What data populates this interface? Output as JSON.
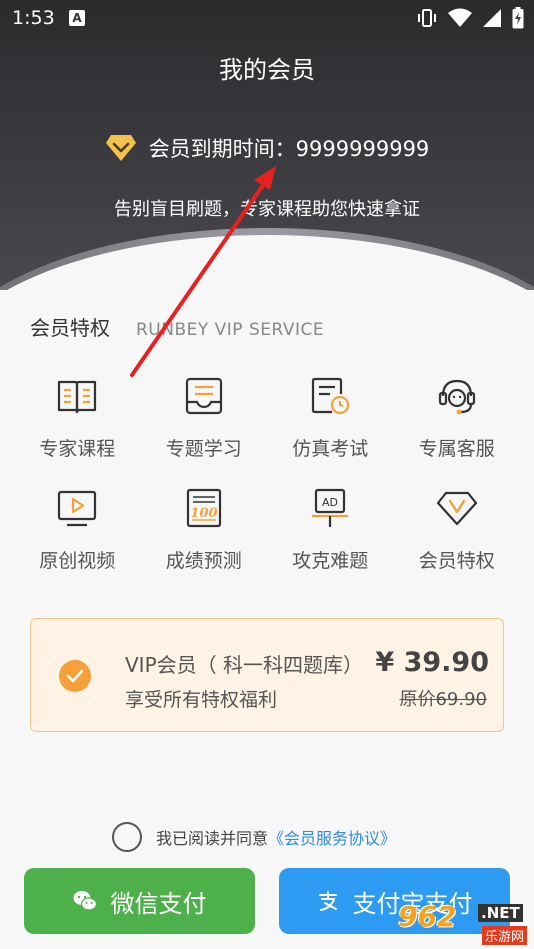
{
  "status_bar": {
    "time": "1:53",
    "notification_letter": "A"
  },
  "header": {
    "title": "我的会员",
    "expiry_label": "会员到期时间：9999999999",
    "slogan": "告别盲目刷题，专家课程助您快速拿证"
  },
  "privileges": {
    "title": "会员特权",
    "subtitle": "RUNBEY VIP SERVICE",
    "items": [
      {
        "label": "专家课程",
        "icon": "book-icon"
      },
      {
        "label": "专题学习",
        "icon": "tray-icon"
      },
      {
        "label": "仿真考试",
        "icon": "exam-clock-icon"
      },
      {
        "label": "专属客服",
        "icon": "headset-icon"
      },
      {
        "label": "原创视频",
        "icon": "video-play-icon"
      },
      {
        "label": "成绩预测",
        "icon": "score-100-icon"
      },
      {
        "label": "攻克难题",
        "icon": "ad-board-icon"
      },
      {
        "label": "会员特权",
        "icon": "vip-diamond-icon"
      }
    ]
  },
  "plan": {
    "name": "VIP会员（ 科一科四题库）",
    "description": "享受所有特权福利",
    "price": "¥ 39.90",
    "original_price": "原价69.90",
    "selected": true
  },
  "agreement": {
    "text": "我已阅读并同意",
    "link": "《会员服务协议》"
  },
  "payment": {
    "wechat_label": "微信支付",
    "alipay_label": "支付宝支付"
  },
  "watermark": {
    "main": "962",
    "net": ".NET",
    "sub": "乐游网"
  },
  "colors": {
    "accent_orange": "#f5a03a",
    "wechat_green": "#4db04a",
    "alipay_blue": "#2e9bf2",
    "link_blue": "#2d8ae8",
    "header_dark": "#2b2b2e",
    "gold": "#f2c14e"
  }
}
